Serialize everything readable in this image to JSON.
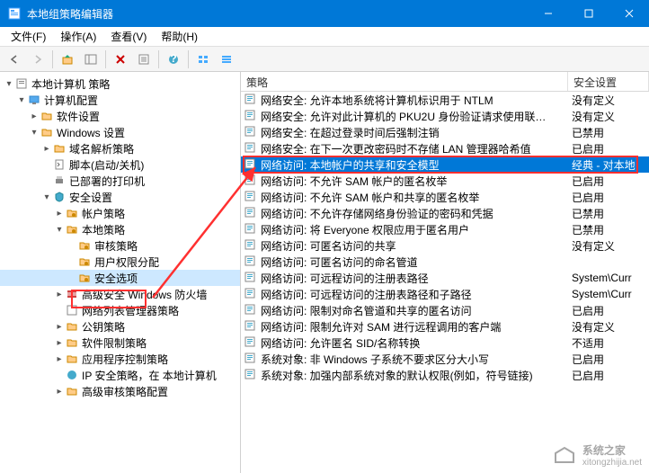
{
  "window": {
    "title": "本地组策略编辑器"
  },
  "menu": {
    "file": "文件(F)",
    "action": "操作(A)",
    "view": "查看(V)",
    "help": "帮助(H)"
  },
  "tree": {
    "root": "本地计算机 策略",
    "computer_config": "计算机配置",
    "software": "软件设置",
    "windows_settings": "Windows 设置",
    "dns_policy": "域名解析策略",
    "scripts": "脚本(启动/关机)",
    "printers": "已部署的打印机",
    "security_settings": "安全设置",
    "account_policy": "帐户策略",
    "local_policy": "本地策略",
    "audit_policy": "审核策略",
    "user_rights": "用户权限分配",
    "security_options": "安全选项",
    "adv_firewall": "高级安全 Windows 防火墙",
    "netlist_mgr": "网络列表管理器策略",
    "pubkey_policy": "公钥策略",
    "sw_restrict": "软件限制策略",
    "app_control": "应用程序控制策略",
    "ip_sec": "IP 安全策略，在 本地计算机",
    "adv_audit": "高级审核策略配置"
  },
  "list": {
    "col1": "策略",
    "col2": "安全设置",
    "rows": [
      {
        "name": "网络安全: 允许本地系统将计算机标识用于 NTLM",
        "val": "没有定义"
      },
      {
        "name": "网络安全: 允许对此计算机的 PKU2U 身份验证请求使用联…",
        "val": "没有定义"
      },
      {
        "name": "网络安全: 在超过登录时间后强制注销",
        "val": "已禁用"
      },
      {
        "name": "网络安全: 在下一次更改密码时不存储 LAN 管理器哈希值",
        "val": "已启用"
      },
      {
        "name": "网络访问: 本地帐户的共享和安全模型",
        "val": "经典 - 对本地"
      },
      {
        "name": "网络访问: 不允许 SAM 帐户的匿名枚举",
        "val": "已启用"
      },
      {
        "name": "网络访问: 不允许 SAM 帐户和共享的匿名枚举",
        "val": "已启用"
      },
      {
        "name": "网络访问: 不允许存储网络身份验证的密码和凭据",
        "val": "已禁用"
      },
      {
        "name": "网络访问: 将 Everyone 权限应用于匿名用户",
        "val": "已禁用"
      },
      {
        "name": "网络访问: 可匿名访问的共享",
        "val": "没有定义"
      },
      {
        "name": "网络访问: 可匿名访问的命名管道",
        "val": ""
      },
      {
        "name": "网络访问: 可远程访问的注册表路径",
        "val": "System\\Curr"
      },
      {
        "name": "网络访问: 可远程访问的注册表路径和子路径",
        "val": "System\\Curr"
      },
      {
        "name": "网络访问: 限制对命名管道和共享的匿名访问",
        "val": "已启用"
      },
      {
        "name": "网络访问: 限制允许对 SAM 进行远程调用的客户端",
        "val": "没有定义"
      },
      {
        "name": "网络访问: 允许匿名 SID/名称转换",
        "val": "不适用"
      },
      {
        "name": "系统对象: 非 Windows 子系统不要求区分大小写",
        "val": "已启用"
      },
      {
        "name": "系统对象: 加强内部系统对象的默认权限(例如，符号链接)",
        "val": "已启用"
      }
    ],
    "selected_index": 4
  },
  "watermark": {
    "main": "系统之家",
    "sub": "xitongzhijia.net"
  }
}
